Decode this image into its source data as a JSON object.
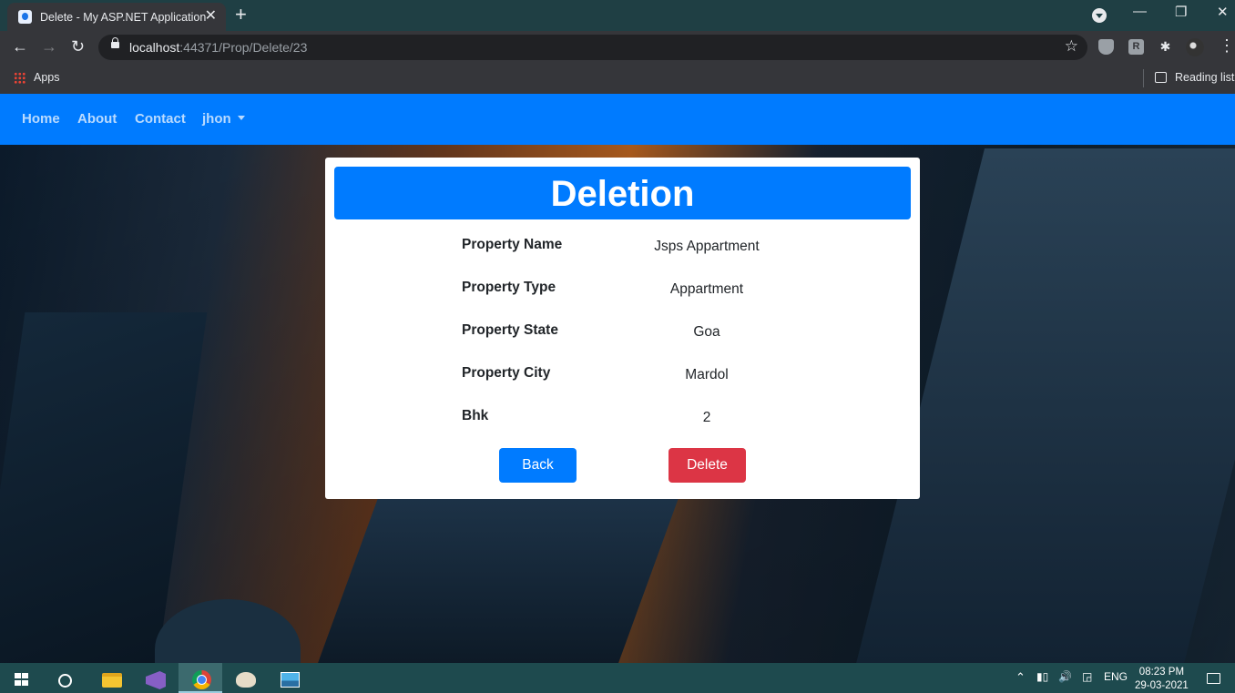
{
  "browser": {
    "tab_title": "Delete - My ASP.NET Application",
    "tab_close": "✕",
    "new_tab": "+",
    "url_host": "localhost",
    "url_rest": ":44371/Prop/Delete/23",
    "bookmarks_apps": "Apps",
    "reading_list": "Reading list",
    "window_controls": {
      "minimize": "—",
      "restore": "❐",
      "close": "✕"
    }
  },
  "navbar": {
    "items": [
      {
        "label": "Home"
      },
      {
        "label": "About"
      },
      {
        "label": "Contact"
      },
      {
        "label": "jhon"
      }
    ]
  },
  "card": {
    "heading": "Deletion",
    "rows": [
      {
        "label": "Property Name",
        "value": "Jsps Appartment"
      },
      {
        "label": "Property Type",
        "value": "Appartment"
      },
      {
        "label": "Property State",
        "value": "Goa"
      },
      {
        "label": "Property City",
        "value": "Mardol"
      },
      {
        "label": "Bhk",
        "value": "2"
      }
    ],
    "back_label": "Back",
    "delete_label": "Delete"
  },
  "taskbar": {
    "language": "ENG",
    "time": "08:23 PM",
    "date": "29-03-2021"
  },
  "colors": {
    "primary": "#007bff",
    "danger": "#dc3545",
    "chrome_frame": "#1f3f44",
    "chrome_toolbar": "#35363a",
    "taskbar": "#1e4a4e"
  }
}
